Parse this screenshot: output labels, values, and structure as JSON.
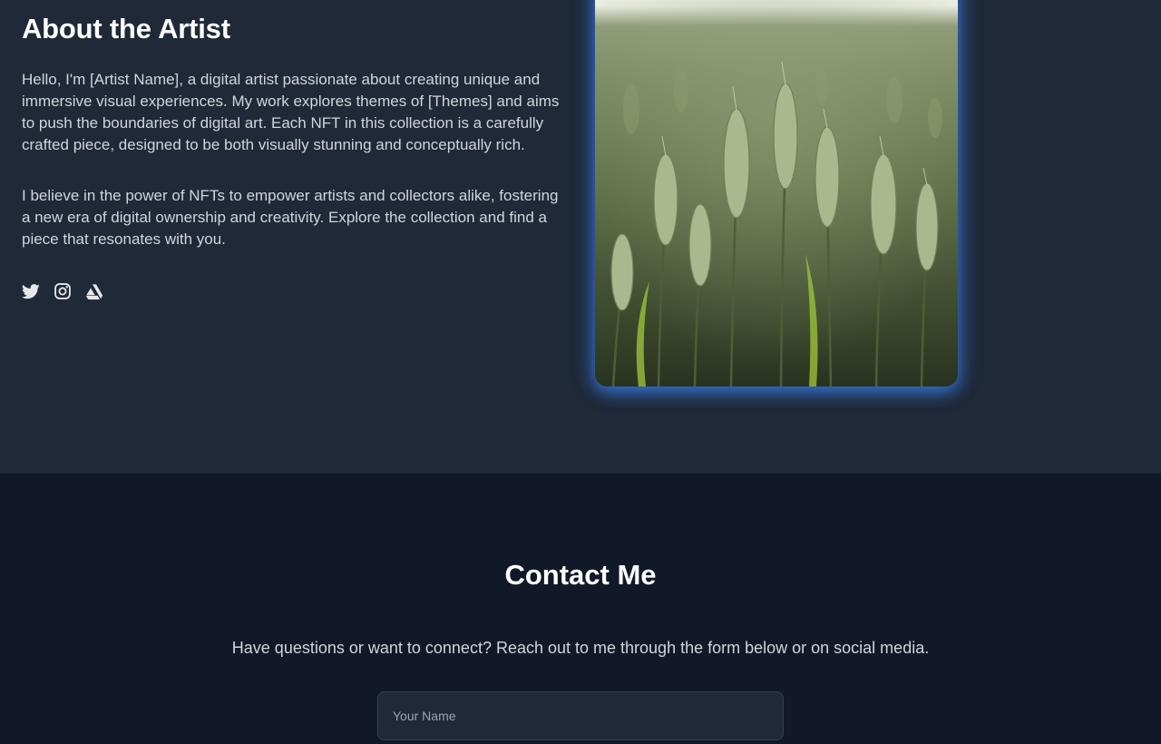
{
  "about": {
    "title": "About the Artist",
    "paragraph1": "Hello, I'm [Artist Name], a digital artist passionate about creating unique and immersive visual experiences. My work explores themes of [Themes] and aims to push the boundaries of digital art. Each NFT in this collection is a carefully crafted piece, designed to be both visually stunning and conceptually rich.",
    "paragraph2": "I believe in the power of NFTs to empower artists and collectors alike, fostering a new era of digital ownership and creativity. Explore the collection and find a piece that resonates with you.",
    "social_icons": [
      "twitter-icon",
      "instagram-icon",
      "artstation-icon"
    ]
  },
  "contact": {
    "title": "Contact Me",
    "subtitle": "Have questions or want to connect? Reach out to me through the form below or on social media.",
    "name_placeholder": "Your Name"
  },
  "colors": {
    "about_bg": "#1f2937",
    "contact_bg": "#111827",
    "text_primary": "#ffffff",
    "text_secondary": "#d1d5db",
    "glow": "#3b82f6",
    "input_bg": "#1f2937",
    "input_border": "#374151"
  }
}
